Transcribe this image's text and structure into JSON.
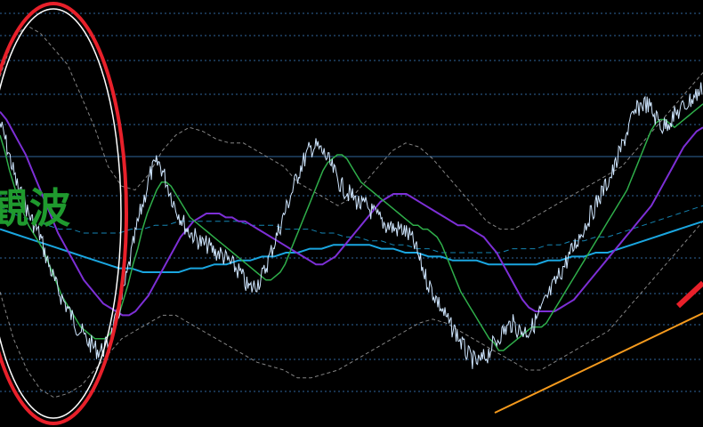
{
  "chart_data": {
    "type": "line",
    "title": "",
    "xlabel": "",
    "ylabel": "",
    "grid": true,
    "ylim": [
      0,
      100
    ],
    "x_count": 200,
    "series": [
      {
        "role": "price",
        "values": [
          73,
          70,
          66,
          62,
          58,
          55,
          53,
          50,
          48,
          46,
          44,
          40,
          37,
          34,
          31,
          29,
          27,
          25,
          23,
          21,
          20,
          18,
          17,
          16,
          15,
          15,
          16,
          18,
          21,
          24,
          28,
          33,
          38,
          43,
          48,
          52,
          56,
          60,
          62,
          63,
          61,
          58,
          55,
          52,
          50,
          48,
          46,
          45,
          44,
          43,
          42,
          42,
          41,
          40,
          40,
          39,
          38,
          37,
          36,
          35,
          33,
          31,
          31,
          32,
          33,
          35,
          38,
          41,
          44,
          47,
          50,
          53,
          56,
          59,
          62,
          64,
          66,
          67,
          67,
          66,
          65,
          63,
          61,
          59,
          57,
          56,
          55,
          54,
          53,
          52,
          52,
          51,
          50,
          49,
          48,
          47,
          47,
          46,
          46,
          46,
          45,
          44,
          42,
          39,
          36,
          33,
          31,
          29,
          27,
          25,
          23,
          21,
          20,
          18,
          16,
          14,
          13,
          12,
          12,
          13,
          14,
          16,
          17,
          19,
          20,
          21,
          22,
          21,
          20,
          20,
          20,
          21,
          23,
          25,
          27,
          29,
          31,
          33,
          35,
          37,
          39,
          41,
          43,
          45,
          47,
          49,
          51,
          53,
          55,
          57,
          59,
          61,
          64,
          67,
          70,
          73,
          75,
          77,
          78,
          78,
          77,
          75,
          74,
          72,
          73,
          74,
          75,
          76,
          77,
          78,
          79,
          80,
          81,
          82
        ]
      },
      {
        "role": "ma-fast",
        "values": [
          70,
          66,
          61,
          57,
          53,
          50,
          47,
          45,
          43,
          41,
          38,
          35,
          32,
          29,
          27,
          25,
          23,
          21,
          20,
          19,
          18,
          18,
          18,
          19,
          21,
          24,
          28,
          32,
          37,
          41,
          46,
          50,
          53,
          56,
          58,
          58,
          57,
          55,
          53,
          51,
          49,
          48,
          47,
          46,
          45,
          44,
          43,
          42,
          41,
          40,
          39,
          38,
          37,
          36,
          35,
          34,
          33,
          33,
          34,
          35,
          37,
          40,
          43,
          46,
          49,
          52,
          55,
          58,
          61,
          63,
          64,
          65,
          65,
          64,
          62,
          60,
          58,
          57,
          56,
          55,
          54,
          53,
          52,
          51,
          50,
          49,
          48,
          47,
          47,
          46,
          46,
          45,
          44,
          42,
          39,
          36,
          33,
          30,
          28,
          26,
          24,
          22,
          20,
          18,
          17,
          15,
          15,
          16,
          17,
          18,
          19,
          20,
          21,
          21,
          21,
          22,
          24,
          26,
          28,
          30,
          32,
          34,
          36,
          38,
          40,
          42,
          44,
          46,
          48,
          50,
          52,
          54,
          56,
          59,
          62,
          65,
          68,
          71,
          73,
          74,
          74,
          73,
          72,
          73,
          74,
          75,
          76,
          77,
          78
        ]
      },
      {
        "role": "ma-mid",
        "values": [
          76,
          74,
          71,
          68,
          65,
          61,
          57,
          53,
          49,
          45,
          42,
          39,
          36,
          33,
          31,
          29,
          27,
          26,
          25,
          24,
          24,
          25,
          27,
          29,
          32,
          35,
          38,
          41,
          44,
          46,
          48,
          49,
          50,
          50,
          50,
          49,
          49,
          48,
          48,
          47,
          46,
          45,
          44,
          43,
          42,
          41,
          40,
          39,
          38,
          37,
          37,
          38,
          39,
          41,
          43,
          45,
          47,
          49,
          51,
          53,
          54,
          55,
          55,
          55,
          54,
          53,
          52,
          51,
          50,
          49,
          48,
          47,
          47,
          46,
          45,
          44,
          42,
          40,
          37,
          34,
          31,
          28,
          26,
          25,
          25,
          25,
          25,
          26,
          27,
          28,
          30,
          32,
          34,
          36,
          38,
          40,
          42,
          44,
          46,
          48,
          50,
          52,
          55,
          58,
          61,
          64,
          67,
          69,
          71,
          72
        ]
      },
      {
        "role": "ma-slow",
        "values": [
          46,
          45,
          44,
          43,
          42,
          41,
          40,
          39,
          38,
          37,
          36,
          36,
          35,
          35,
          35,
          35,
          36,
          36,
          37,
          37,
          38,
          38,
          39,
          39,
          40,
          40,
          41,
          41,
          42,
          42,
          42,
          42,
          41,
          41,
          40,
          40,
          39,
          39,
          38,
          38,
          38,
          37,
          37,
          37,
          37,
          37,
          38,
          38,
          39,
          39,
          40,
          40,
          41,
          42,
          43,
          44,
          45,
          46,
          47,
          48
        ]
      },
      {
        "role": "ma-slow-dashed",
        "values": [
          52,
          50,
          49,
          48,
          47,
          46,
          46,
          45,
          45,
          45,
          45,
          46,
          46,
          47,
          47,
          48,
          48,
          48,
          48,
          48,
          48,
          47,
          47,
          47,
          46,
          46,
          46,
          45,
          45,
          44,
          44,
          43,
          43,
          42,
          42,
          41,
          41,
          40,
          40,
          40,
          40,
          40,
          40,
          41,
          41,
          41,
          42,
          42,
          43,
          43,
          44,
          44,
          45,
          46,
          47,
          48,
          49,
          50,
          51,
          52
        ]
      },
      {
        "role": "band-upper",
        "values": [
          85,
          95,
          98,
          96,
          92,
          88,
          80,
          72,
          62,
          57,
          56,
          60,
          66,
          70,
          72,
          71,
          69,
          68,
          68,
          66,
          64,
          62,
          58,
          56,
          54,
          52,
          54,
          58,
          62,
          66,
          68,
          67,
          64,
          60,
          56,
          52,
          48,
          46,
          46,
          48,
          50,
          52,
          54,
          56,
          58,
          60,
          62,
          66,
          70,
          74,
          78,
          82,
          86
        ]
      },
      {
        "role": "band-lower",
        "values": [
          30,
          18,
          10,
          5,
          3,
          4,
          6,
          10,
          14,
          18,
          20,
          22,
          24,
          24,
          22,
          20,
          18,
          16,
          14,
          12,
          11,
          10,
          8,
          8,
          9,
          10,
          12,
          14,
          16,
          18,
          20,
          22,
          23,
          22,
          20,
          18,
          16,
          14,
          12,
          10,
          10,
          12,
          14,
          16,
          18,
          20,
          24,
          28,
          32,
          36,
          40,
          44,
          48
        ]
      }
    ]
  },
  "annotation": {
    "text": "観波",
    "ellipse_color": "#e8202a",
    "trendline_color": "#f59a1d",
    "arrow_color": "#e8202a"
  },
  "colors": {
    "background": "#000000",
    "grid": "#3a78b8",
    "price": "#cfe6ff",
    "ma_fast": "#2fae4a",
    "ma_mid": "#7d2fd6",
    "ma_slow": "#1aa6e0",
    "band": "#bdbdbd"
  }
}
